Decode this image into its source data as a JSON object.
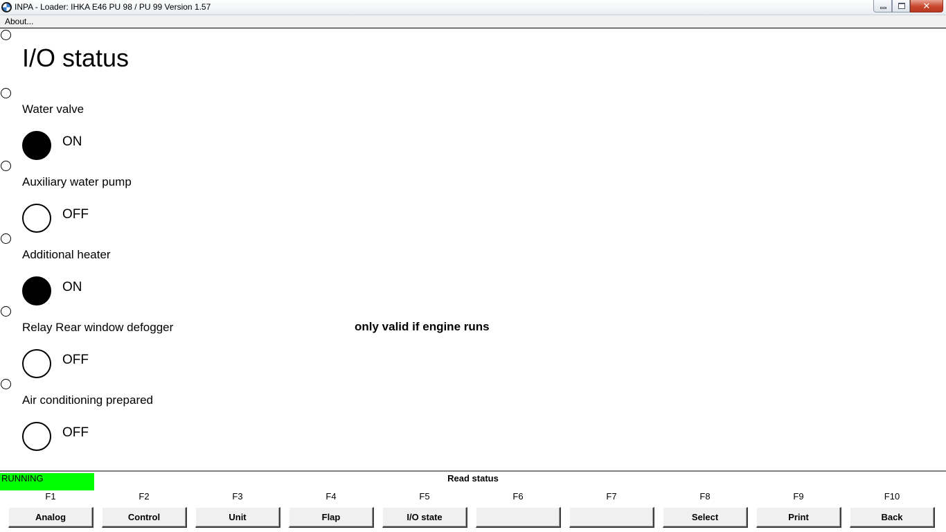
{
  "window": {
    "title": "INPA - Loader:  IHKA E46 PU 98 / PU 99 Version 1.57",
    "icon": "bmw-logo-icon",
    "close_symbol": "✕"
  },
  "menu": {
    "about": "About..."
  },
  "main": {
    "heading": "I/O status",
    "note": "only valid if engine runs",
    "items": [
      {
        "label": "Water valve",
        "state": "ON",
        "on": true
      },
      {
        "label": "Auxiliary water pump",
        "state": "OFF",
        "on": false
      },
      {
        "label": "Additional heater",
        "state": "ON",
        "on": true
      },
      {
        "label": "Relay Rear window defogger",
        "state": "OFF",
        "on": false
      },
      {
        "label": "Air conditioning prepared",
        "state": "OFF",
        "on": false
      }
    ]
  },
  "status": {
    "running": "RUNNING",
    "running_color": "#00ff00",
    "mode": "Read status"
  },
  "fkeys": [
    {
      "key": "F1",
      "label": "Analog"
    },
    {
      "key": "F2",
      "label": "Control"
    },
    {
      "key": "F3",
      "label": "Unit"
    },
    {
      "key": "F4",
      "label": "Flap"
    },
    {
      "key": "F5",
      "label": "I/O state"
    },
    {
      "key": "F6",
      "label": ""
    },
    {
      "key": "F7",
      "label": ""
    },
    {
      "key": "F8",
      "label": "Select"
    },
    {
      "key": "F9",
      "label": "Print"
    },
    {
      "key": "F10",
      "label": "Back"
    }
  ]
}
